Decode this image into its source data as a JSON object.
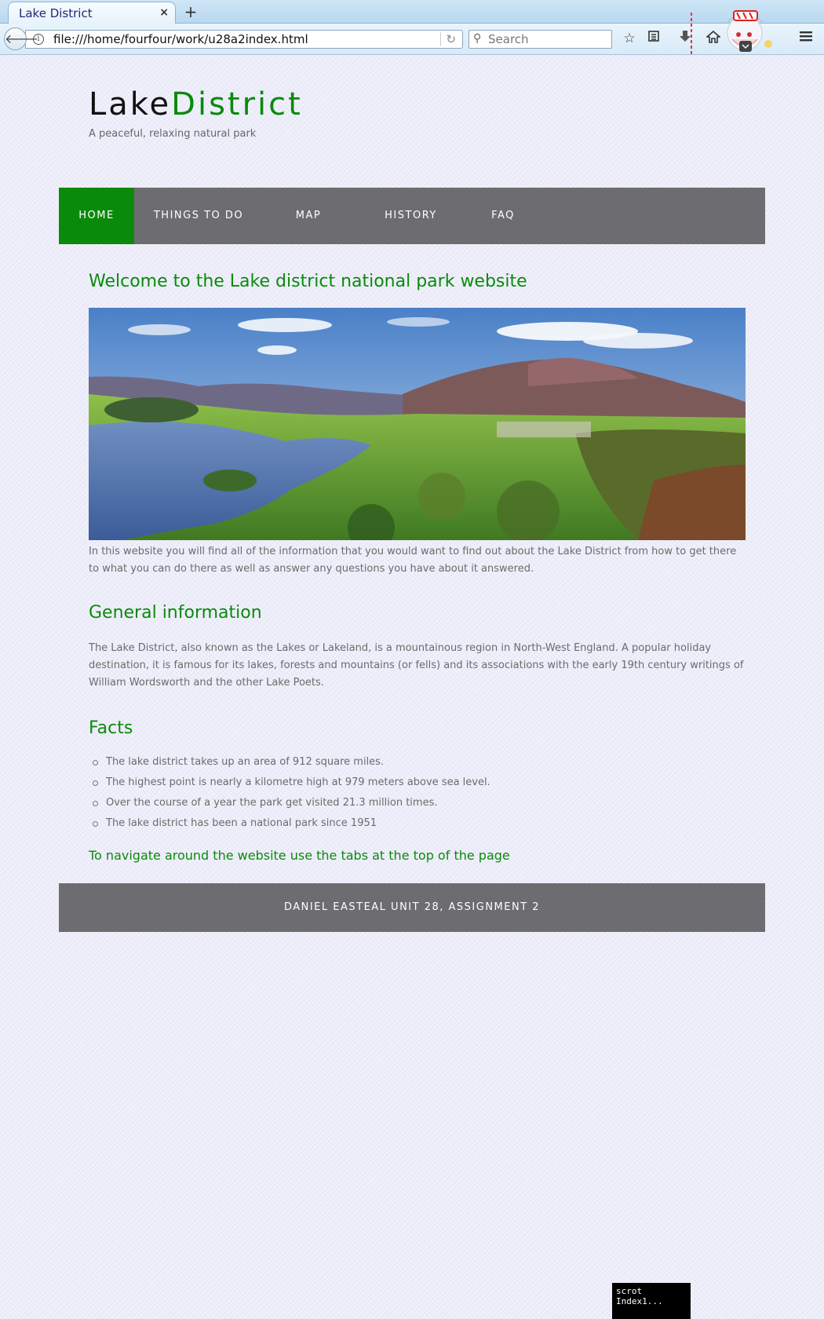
{
  "browser": {
    "tab_title": "Lake District",
    "tab_close": "×",
    "new_tab": "+",
    "url": "file:///home/fourfour/work/u28a2index.html",
    "search_placeholder": "Search",
    "icons": [
      "back-icon",
      "info-icon",
      "reload-icon",
      "search-icon",
      "bookmark-star-icon",
      "reader-list-icon",
      "download-icon",
      "home-icon",
      "pocket-icon",
      "menu-icon"
    ]
  },
  "site": {
    "title_part1": "Lake",
    "title_part2": "District",
    "tagline": "A peaceful, relaxing natural park",
    "accent_color": "#0a8a0a",
    "nav_color": "#6b6a6e"
  },
  "nav": {
    "items": [
      {
        "label": "HOME",
        "active": true
      },
      {
        "label": "THINGS TO DO",
        "active": false
      },
      {
        "label": "MAP",
        "active": false
      },
      {
        "label": "HISTORY",
        "active": false
      },
      {
        "label": "FAQ",
        "active": false
      }
    ]
  },
  "main": {
    "welcome_heading": "Welcome to the Lake district national park website",
    "intro": "In this website you will find all of the information that you would want to find out about the Lake District from how to get there to what you can do there as well as answer any questions you have about it answered.",
    "general_heading": "General information",
    "general_text": "The Lake District, also known as the Lakes or Lakeland, is a mountainous region in North-West England. A popular holiday destination, it is famous for its lakes, forests and mountains (or fells) and its associations with the early 19th century writings of William Wordsworth and the other Lake Poets.",
    "facts_heading": "Facts",
    "facts": [
      "The lake district takes up an area of 912 square miles.",
      "The highest point is nearly a kilometre high at 979 meters above sea level.",
      "Over the course of a year the park get visited 21.3 million times.",
      "The lake district has been a national park since 1951"
    ],
    "nav_hint": "To navigate around the website use the tabs at the top of the page"
  },
  "footer": {
    "text": "DANIEL EASTEAL UNIT 28, ASSIGNMENT 2"
  },
  "taskbar": {
    "item_label": "scrot Index1..."
  }
}
